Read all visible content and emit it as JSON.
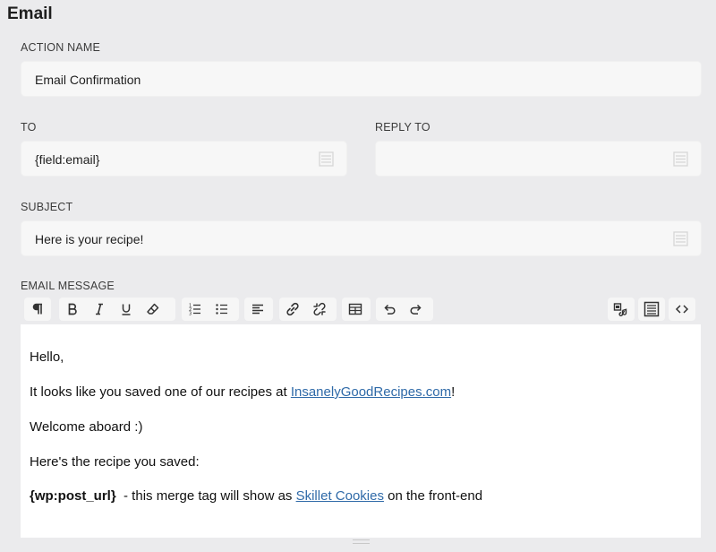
{
  "section": {
    "title": "Email"
  },
  "action_name": {
    "label": "ACTION NAME",
    "value": "Email Confirmation"
  },
  "to": {
    "label": "TO",
    "value": "{field:email}"
  },
  "reply_to": {
    "label": "REPLY TO",
    "value": ""
  },
  "subject": {
    "label": "SUBJECT",
    "value": "Here is your recipe!"
  },
  "message": {
    "label": "EMAIL MESSAGE",
    "toolbar": [
      "paragraph-icon",
      "bold-icon",
      "italic-icon",
      "underline-icon",
      "clear-format-icon",
      "ordered-list-icon",
      "unordered-list-icon",
      "align-left-icon",
      "link-icon",
      "unlink-icon",
      "table-icon",
      "undo-icon",
      "redo-icon",
      "media-icon",
      "merge-tags-icon",
      "code-view-icon"
    ],
    "line1": "Hello,",
    "line2_prefix": "It looks like you saved one of our recipes at ",
    "line2_link": "InsanelyGoodRecipes.com",
    "line2_suffix": "!",
    "line3": "Welcome aboard :)",
    "line4": "Here's the recipe you saved:",
    "line5_tag": "{wp:post_url}",
    "line5_middle": "  - this merge tag will show as ",
    "line5_link": "Skillet Cookies",
    "line5_suffix": " on the front-end",
    "colors": {
      "link": "#2f6aa8",
      "field_bg": "#f7f7f7",
      "page_bg": "#ebebed"
    }
  }
}
